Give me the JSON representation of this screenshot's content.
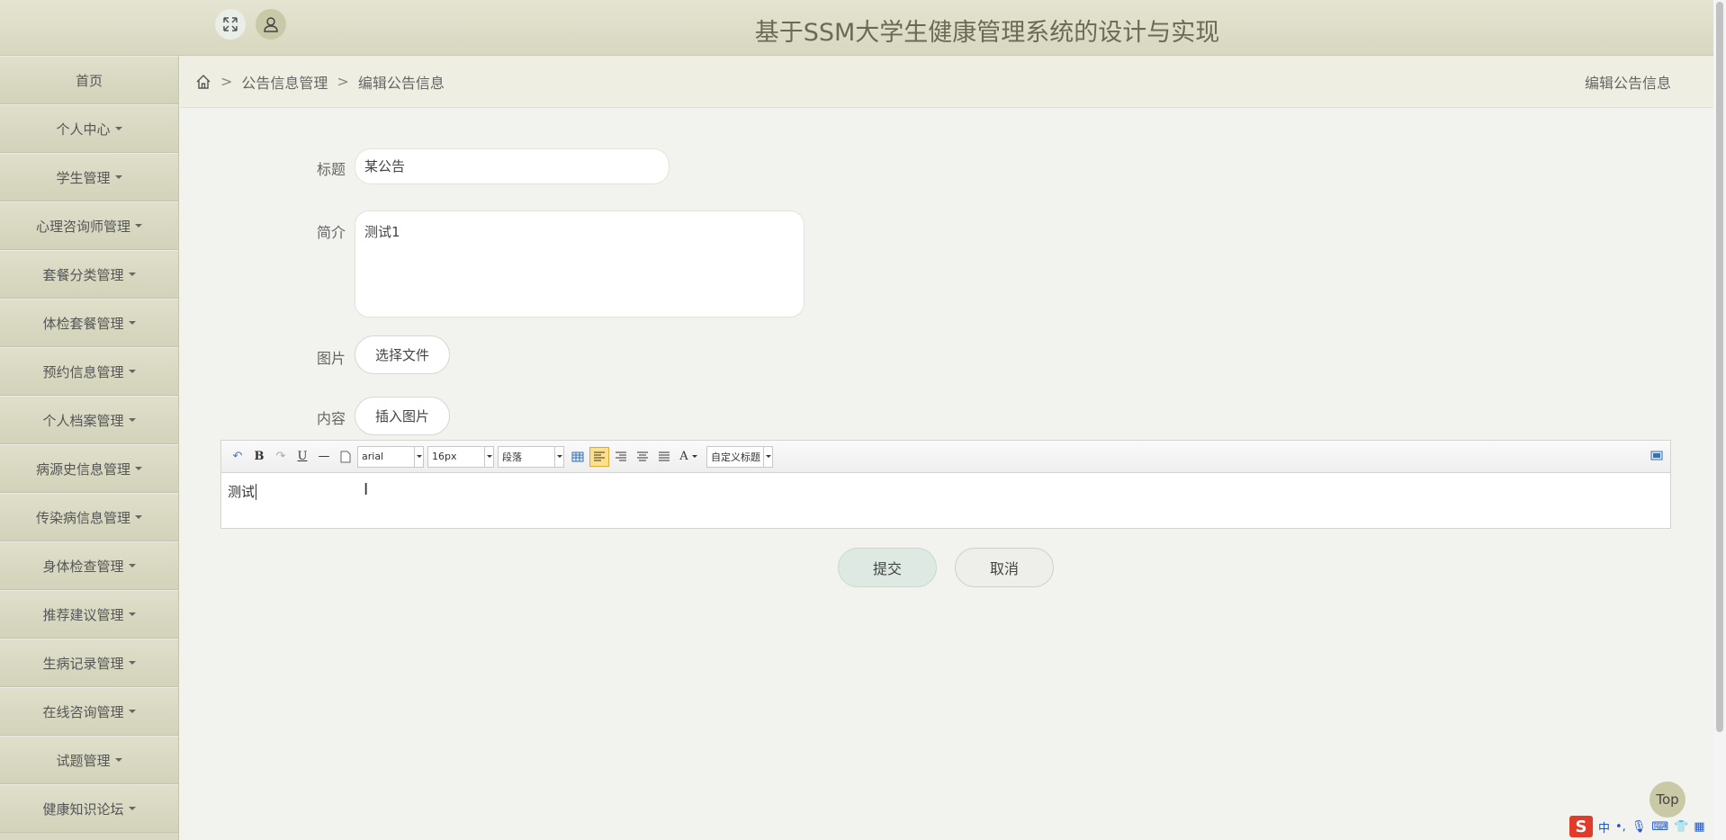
{
  "header": {
    "title": "基于SSM大学生健康管理系统的设计与实现",
    "expand_icon": "expand-icon",
    "user_icon": "user-icon"
  },
  "sidebar": {
    "items": [
      {
        "label": "首页",
        "has_caret": false
      },
      {
        "label": "个人中心",
        "has_caret": true
      },
      {
        "label": "学生管理",
        "has_caret": true
      },
      {
        "label": "心理咨询师管理",
        "has_caret": true
      },
      {
        "label": "套餐分类管理",
        "has_caret": true
      },
      {
        "label": "体检套餐管理",
        "has_caret": true
      },
      {
        "label": "预约信息管理",
        "has_caret": true
      },
      {
        "label": "个人档案管理",
        "has_caret": true
      },
      {
        "label": "病源史信息管理",
        "has_caret": true
      },
      {
        "label": "传染病信息管理",
        "has_caret": true
      },
      {
        "label": "身体检查管理",
        "has_caret": true
      },
      {
        "label": "推荐建议管理",
        "has_caret": true
      },
      {
        "label": "生病记录管理",
        "has_caret": true
      },
      {
        "label": "在线咨询管理",
        "has_caret": true
      },
      {
        "label": "试题管理",
        "has_caret": true
      },
      {
        "label": "健康知识论坛",
        "has_caret": true
      }
    ]
  },
  "breadcrumb": {
    "sep": ">",
    "level1": "公告信息管理",
    "level2": "编辑公告信息",
    "right_title": "编辑公告信息"
  },
  "form": {
    "title_label": "标题",
    "title_value": "某公告",
    "intro_label": "简介",
    "intro_value": "测试1",
    "image_label": "图片",
    "image_button": "选择文件",
    "content_label": "内容",
    "content_button": "插入图片"
  },
  "editor": {
    "font_family": "arial",
    "font_size": "16px",
    "paragraph": "段落",
    "custom_heading": "自定义标题",
    "content": "测试"
  },
  "actions": {
    "submit": "提交",
    "cancel": "取消"
  },
  "top_button": "Top",
  "ime": {
    "lang": "中",
    "punct": "•,"
  }
}
